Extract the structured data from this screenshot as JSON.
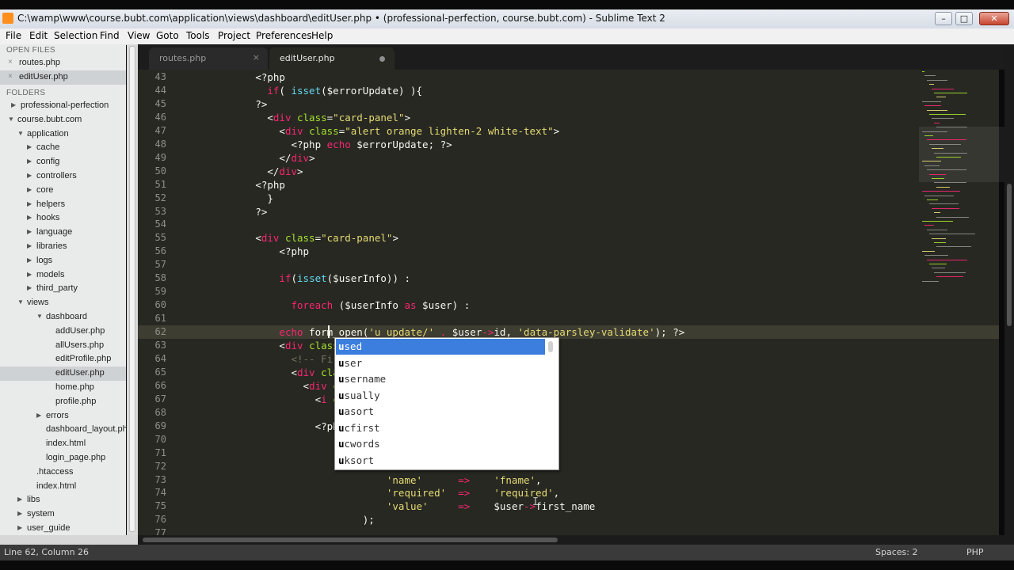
{
  "window": {
    "title": "C:\\wamp\\www\\course.bubt.com\\application\\views\\dashboard\\editUser.php • (professional-perfection, course.bubt.com) - Sublime Text 2"
  },
  "menu": [
    "File",
    "Edit",
    "Selection",
    "Find",
    "View",
    "Goto",
    "Tools",
    "Project",
    "Preferences",
    "Help"
  ],
  "sidebar": {
    "open_files_header": "OPEN FILES",
    "open_files": [
      {
        "label": "routes.php",
        "selected": false
      },
      {
        "label": "editUser.php",
        "selected": true
      }
    ],
    "folders_header": "FOLDERS",
    "tree": [
      {
        "label": "professional-perfection",
        "expanded": false,
        "folder": true,
        "selected": false
      },
      {
        "label": "course.bubt.com",
        "expanded": true,
        "folder": true,
        "selected": false
      },
      {
        "label": "application",
        "expanded": true,
        "folder": true,
        "selected": false
      },
      {
        "label": "cache",
        "expanded": false,
        "folder": true,
        "selected": false
      },
      {
        "label": "config",
        "expanded": false,
        "folder": true,
        "selected": false
      },
      {
        "label": "controllers",
        "expanded": false,
        "folder": true,
        "selected": false
      },
      {
        "label": "core",
        "expanded": false,
        "folder": true,
        "selected": false
      },
      {
        "label": "helpers",
        "expanded": false,
        "folder": true,
        "selected": false
      },
      {
        "label": "hooks",
        "expanded": false,
        "folder": true,
        "selected": false
      },
      {
        "label": "language",
        "expanded": false,
        "folder": true,
        "selected": false
      },
      {
        "label": "libraries",
        "expanded": false,
        "folder": true,
        "selected": false
      },
      {
        "label": "logs",
        "expanded": false,
        "folder": true,
        "selected": false
      },
      {
        "label": "models",
        "expanded": false,
        "folder": true,
        "selected": false
      },
      {
        "label": "third_party",
        "expanded": false,
        "folder": true,
        "selected": false
      },
      {
        "label": "views",
        "expanded": true,
        "folder": true,
        "selected": false
      },
      {
        "label": "dashboard",
        "expanded": true,
        "folder": true,
        "selected": false
      },
      {
        "label": "addUser.php",
        "expanded": false,
        "folder": false,
        "selected": false
      },
      {
        "label": "allUsers.php",
        "expanded": false,
        "folder": false,
        "selected": false
      },
      {
        "label": "editProfile.php",
        "expanded": false,
        "folder": false,
        "selected": false
      },
      {
        "label": "editUser.php",
        "expanded": false,
        "folder": false,
        "selected": true
      },
      {
        "label": "home.php",
        "expanded": false,
        "folder": false,
        "selected": false
      },
      {
        "label": "profile.php",
        "expanded": false,
        "folder": false,
        "selected": false
      },
      {
        "label": "errors",
        "expanded": false,
        "folder": true,
        "selected": false
      },
      {
        "label": "dashboard_layout.php",
        "expanded": false,
        "folder": false,
        "selected": false
      },
      {
        "label": "index.html",
        "expanded": false,
        "folder": false,
        "selected": false
      },
      {
        "label": "login_page.php",
        "expanded": false,
        "folder": false,
        "selected": false
      },
      {
        "label": ".htaccess",
        "expanded": false,
        "folder": false,
        "selected": false
      },
      {
        "label": "index.html",
        "expanded": false,
        "folder": false,
        "selected": false
      },
      {
        "label": "libs",
        "expanded": false,
        "folder": true,
        "selected": false
      },
      {
        "label": "system",
        "expanded": false,
        "folder": true,
        "selected": false
      },
      {
        "label": "user_guide",
        "expanded": false,
        "folder": true,
        "selected": false
      }
    ]
  },
  "tabs": [
    {
      "label": "routes.php",
      "active": false,
      "close_glyph": "×"
    },
    {
      "label": "editUser.php",
      "active": true,
      "modified": true
    }
  ],
  "editor": {
    "current_line": 62,
    "lines": [
      {
        "n": 43,
        "tokens": [
          [
            "            ",
            ""
          ],
          [
            "<?php",
            "tg"
          ]
        ]
      },
      {
        "n": 44,
        "tokens": [
          [
            "              ",
            ""
          ],
          [
            "if",
            "kw"
          ],
          [
            "( ",
            ""
          ],
          [
            "isset",
            "fn"
          ],
          [
            "(",
            ""
          ],
          [
            "$errorUpdate",
            ""
          ],
          [
            ") ){",
            ""
          ]
        ]
      },
      {
        "n": 45,
        "tokens": [
          [
            "            ",
            ""
          ],
          [
            "?>",
            "tg"
          ]
        ]
      },
      {
        "n": 46,
        "tokens": [
          [
            "              ",
            ""
          ],
          [
            "<",
            "tg"
          ],
          [
            "div",
            "tn"
          ],
          [
            " ",
            ""
          ],
          [
            "class",
            "at"
          ],
          [
            "=",
            ""
          ],
          [
            "\"card-panel\"",
            "st"
          ],
          [
            ">",
            "tg"
          ]
        ]
      },
      {
        "n": 47,
        "tokens": [
          [
            "                ",
            ""
          ],
          [
            "<",
            "tg"
          ],
          [
            "div",
            "tn"
          ],
          [
            " ",
            ""
          ],
          [
            "class",
            "at"
          ],
          [
            "=",
            ""
          ],
          [
            "\"alert orange lighten-2 white-text\"",
            "st"
          ],
          [
            ">",
            "tg"
          ]
        ]
      },
      {
        "n": 48,
        "tokens": [
          [
            "                  ",
            ""
          ],
          [
            "<?php",
            "tg"
          ],
          [
            " ",
            ""
          ],
          [
            "echo",
            "kw"
          ],
          [
            " $errorUpdate; ",
            ""
          ],
          [
            "?>",
            "tg"
          ]
        ]
      },
      {
        "n": 49,
        "tokens": [
          [
            "                ",
            ""
          ],
          [
            "</",
            "tg"
          ],
          [
            "div",
            "tn"
          ],
          [
            ">",
            "tg"
          ]
        ]
      },
      {
        "n": 50,
        "tokens": [
          [
            "              ",
            ""
          ],
          [
            "</",
            "tg"
          ],
          [
            "div",
            "tn"
          ],
          [
            ">",
            "tg"
          ]
        ]
      },
      {
        "n": 51,
        "tokens": [
          [
            "            ",
            ""
          ],
          [
            "<?php",
            "tg"
          ]
        ]
      },
      {
        "n": 52,
        "tokens": [
          [
            "              ",
            ""
          ],
          [
            "}",
            ""
          ]
        ]
      },
      {
        "n": 53,
        "tokens": [
          [
            "            ",
            ""
          ],
          [
            "?>",
            "tg"
          ]
        ]
      },
      {
        "n": 54,
        "tokens": [
          [
            "",
            ""
          ]
        ]
      },
      {
        "n": 55,
        "tokens": [
          [
            "            ",
            ""
          ],
          [
            "<",
            "tg"
          ],
          [
            "div",
            "tn"
          ],
          [
            " ",
            ""
          ],
          [
            "class",
            "at"
          ],
          [
            "=",
            ""
          ],
          [
            "\"card-panel\"",
            "st"
          ],
          [
            ">",
            "tg"
          ]
        ]
      },
      {
        "n": 56,
        "tokens": [
          [
            "                ",
            ""
          ],
          [
            "<?php",
            "tg"
          ]
        ]
      },
      {
        "n": 57,
        "tokens": [
          [
            "",
            ""
          ]
        ]
      },
      {
        "n": 58,
        "tokens": [
          [
            "                ",
            ""
          ],
          [
            "if",
            "kw"
          ],
          [
            "(",
            ""
          ],
          [
            "isset",
            "fn"
          ],
          [
            "($userInfo)) :",
            ""
          ]
        ]
      },
      {
        "n": 59,
        "tokens": [
          [
            "",
            ""
          ]
        ]
      },
      {
        "n": 60,
        "tokens": [
          [
            "                  ",
            ""
          ],
          [
            "foreach",
            "kw"
          ],
          [
            " ($userInfo ",
            ""
          ],
          [
            "as",
            "kw"
          ],
          [
            " $user) :",
            ""
          ]
        ]
      },
      {
        "n": 61,
        "tokens": [
          [
            "",
            ""
          ]
        ]
      },
      {
        "n": 62,
        "tokens": [
          [
            "                ",
            ""
          ],
          [
            "echo",
            "tn"
          ],
          [
            " form_open(",
            ""
          ],
          [
            "'u_update/'",
            "st"
          ],
          [
            " ",
            ""
          ],
          [
            ".",
            "kw"
          ],
          [
            " $user",
            ""
          ],
          [
            "->",
            "kw"
          ],
          [
            "id, ",
            ""
          ],
          [
            "'data-parsley-validate'",
            "st"
          ],
          [
            "); ",
            ""
          ],
          [
            "?>",
            "tg"
          ]
        ]
      },
      {
        "n": 63,
        "tokens": [
          [
            "                ",
            ""
          ],
          [
            "<",
            "tg"
          ],
          [
            "div",
            "tn"
          ],
          [
            " ",
            ""
          ],
          [
            "class",
            "at"
          ],
          [
            "=",
            ""
          ],
          [
            "\"row\"",
            "st"
          ],
          [
            ">",
            "tg"
          ]
        ]
      },
      {
        "n": 64,
        "tokens": [
          [
            "                  ",
            ""
          ],
          [
            "<!-- First Name",
            "cm"
          ]
        ]
      },
      {
        "n": 65,
        "tokens": [
          [
            "                  ",
            ""
          ],
          [
            "<",
            "tg"
          ],
          [
            "div",
            "tn"
          ],
          [
            " ",
            ""
          ],
          [
            "class",
            "at"
          ],
          [
            "=",
            ""
          ],
          [
            "\"col",
            "st"
          ]
        ]
      },
      {
        "n": 66,
        "tokens": [
          [
            "                    ",
            ""
          ],
          [
            "<",
            "tg"
          ],
          [
            "div",
            "tn"
          ],
          [
            " ",
            ""
          ],
          [
            "class",
            "at"
          ],
          [
            "=",
            ""
          ],
          [
            "\"i",
            "st"
          ]
        ]
      },
      {
        "n": 67,
        "tokens": [
          [
            "                      ",
            ""
          ],
          [
            "<",
            "tg"
          ],
          [
            "i",
            "tn"
          ],
          [
            " ",
            ""
          ],
          [
            "class",
            "at"
          ],
          [
            "=",
            ""
          ],
          [
            "\"f",
            "st"
          ]
        ]
      },
      {
        "n": 68,
        "tokens": [
          [
            "",
            ""
          ]
        ]
      },
      {
        "n": 69,
        "tokens": [
          [
            "                      ",
            ""
          ],
          [
            "<?php",
            "tg"
          ]
        ]
      },
      {
        "n": 70,
        "tokens": [
          [
            "",
            ""
          ]
        ]
      },
      {
        "n": 71,
        "tokens": [
          [
            "                              ",
            ""
          ],
          [
            "$fi",
            ""
          ]
        ]
      },
      {
        "n": 72,
        "tokens": [
          [
            "",
            ""
          ]
        ]
      },
      {
        "n": 73,
        "tokens": [
          [
            "                                  ",
            ""
          ],
          [
            "'name'",
            "st"
          ],
          [
            "      ",
            ""
          ],
          [
            "=>",
            "kw"
          ],
          [
            "    ",
            ""
          ],
          [
            "'fname'",
            "st"
          ],
          [
            ",",
            ""
          ]
        ]
      },
      {
        "n": 74,
        "tokens": [
          [
            "                                  ",
            ""
          ],
          [
            "'required'",
            "st"
          ],
          [
            "  ",
            ""
          ],
          [
            "=>",
            "kw"
          ],
          [
            "    ",
            ""
          ],
          [
            "'required'",
            "st"
          ],
          [
            ",",
            ""
          ]
        ]
      },
      {
        "n": 75,
        "tokens": [
          [
            "                                  ",
            ""
          ],
          [
            "'value'",
            "st"
          ],
          [
            "     ",
            ""
          ],
          [
            "=>",
            "kw"
          ],
          [
            "    ",
            ""
          ],
          [
            "$user",
            ""
          ],
          [
            "->",
            "kw"
          ],
          [
            "first_name",
            ""
          ]
        ]
      },
      {
        "n": 76,
        "tokens": [
          [
            "                              );",
            ""
          ]
        ]
      },
      {
        "n": 77,
        "tokens": [
          [
            "",
            ""
          ]
        ]
      }
    ]
  },
  "autocomplete": {
    "typed_prefix": "u",
    "items": [
      {
        "label": "used",
        "selected": true
      },
      {
        "label": "user",
        "selected": false
      },
      {
        "label": "username",
        "selected": false
      },
      {
        "label": "usually",
        "selected": false
      },
      {
        "label": "uasort",
        "selected": false
      },
      {
        "label": "ucfirst",
        "selected": false
      },
      {
        "label": "ucwords",
        "selected": false
      },
      {
        "label": "uksort",
        "selected": false
      }
    ]
  },
  "status": {
    "position": "Line 62, Column 26",
    "indent": "Spaces: 2",
    "syntax": "PHP"
  },
  "colors": {
    "editor_bg": "#272822",
    "keyword": "#f92672",
    "string": "#e6db74",
    "tag": "#f8f8f2",
    "tagname": "#f92672",
    "attribute": "#a6e22e",
    "function": "#66d9ef",
    "comment": "#75715e",
    "selection": "#3b7ede"
  }
}
